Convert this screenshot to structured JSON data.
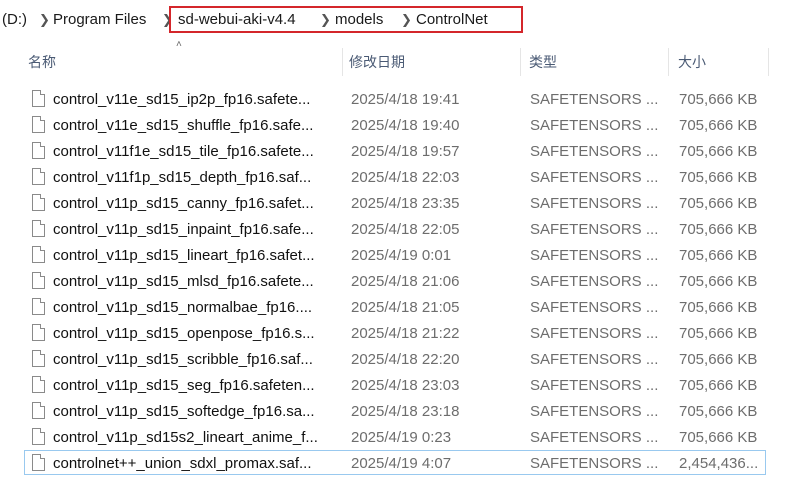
{
  "breadcrumb": {
    "drive": "(D:)",
    "items": [
      "Program Files",
      "sd-webui-aki-v4.4",
      "models",
      "ControlNet"
    ]
  },
  "columns": {
    "name": "名称",
    "modified": "修改日期",
    "type": "类型",
    "size": "大小"
  },
  "files": [
    {
      "name": "control_v11e_sd15_ip2p_fp16.safete...",
      "date": "2025/4/18 19:41",
      "type": "SAFETENSORS ...",
      "size": "705,666 KB"
    },
    {
      "name": "control_v11e_sd15_shuffle_fp16.safe...",
      "date": "2025/4/18 19:40",
      "type": "SAFETENSORS ...",
      "size": "705,666 KB"
    },
    {
      "name": "control_v11f1e_sd15_tile_fp16.safete...",
      "date": "2025/4/18 19:57",
      "type": "SAFETENSORS ...",
      "size": "705,666 KB"
    },
    {
      "name": "control_v11f1p_sd15_depth_fp16.saf...",
      "date": "2025/4/18 22:03",
      "type": "SAFETENSORS ...",
      "size": "705,666 KB"
    },
    {
      "name": "control_v11p_sd15_canny_fp16.safet...",
      "date": "2025/4/18 23:35",
      "type": "SAFETENSORS ...",
      "size": "705,666 KB"
    },
    {
      "name": "control_v11p_sd15_inpaint_fp16.safe...",
      "date": "2025/4/18 22:05",
      "type": "SAFETENSORS ...",
      "size": "705,666 KB"
    },
    {
      "name": "control_v11p_sd15_lineart_fp16.safet...",
      "date": "2025/4/19 0:01",
      "type": "SAFETENSORS ...",
      "size": "705,666 KB"
    },
    {
      "name": "control_v11p_sd15_mlsd_fp16.safete...",
      "date": "2025/4/18 21:06",
      "type": "SAFETENSORS ...",
      "size": "705,666 KB"
    },
    {
      "name": "control_v11p_sd15_normalbae_fp16....",
      "date": "2025/4/18 21:05",
      "type": "SAFETENSORS ...",
      "size": "705,666 KB"
    },
    {
      "name": "control_v11p_sd15_openpose_fp16.s...",
      "date": "2025/4/18 21:22",
      "type": "SAFETENSORS ...",
      "size": "705,666 KB"
    },
    {
      "name": "control_v11p_sd15_scribble_fp16.saf...",
      "date": "2025/4/18 22:20",
      "type": "SAFETENSORS ...",
      "size": "705,666 KB"
    },
    {
      "name": "control_v11p_sd15_seg_fp16.safeten...",
      "date": "2025/4/18 23:03",
      "type": "SAFETENSORS ...",
      "size": "705,666 KB"
    },
    {
      "name": "control_v11p_sd15_softedge_fp16.sa...",
      "date": "2025/4/18 23:18",
      "type": "SAFETENSORS ...",
      "size": "705,666 KB"
    },
    {
      "name": "control_v11p_sd15s2_lineart_anime_f...",
      "date": "2025/4/19 0:23",
      "type": "SAFETENSORS ...",
      "size": "705,666 KB"
    },
    {
      "name": "controlnet++_union_sdxl_promax.saf...",
      "date": "2025/4/19 4:07",
      "type": "SAFETENSORS ...",
      "size": "2,454,436..."
    }
  ],
  "colors": {
    "highlight_box": "#d4262b",
    "header_text": "#4a5a74",
    "selected_row_border": "#99c9ef"
  }
}
